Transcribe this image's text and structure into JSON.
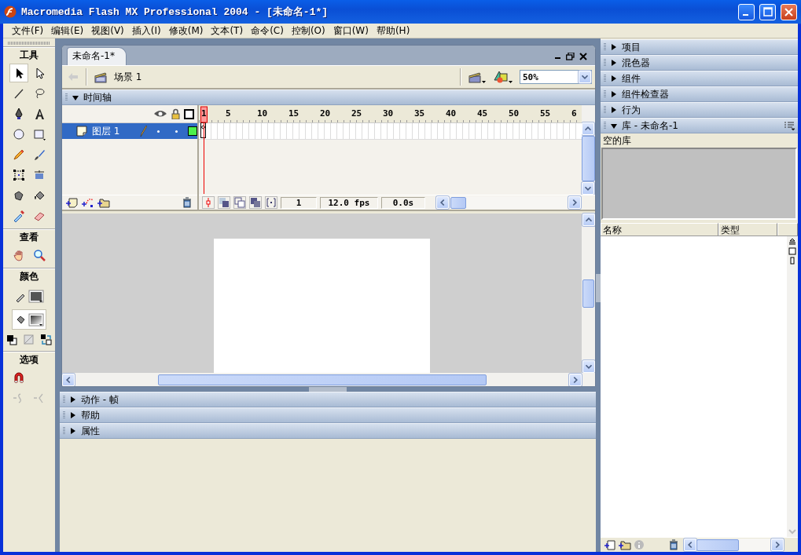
{
  "window": {
    "title": "Macromedia Flash MX Professional 2004 - [未命名-1*]"
  },
  "menu": [
    {
      "label": "文件(F)"
    },
    {
      "label": "编辑(E)"
    },
    {
      "label": "视图(V)"
    },
    {
      "label": "插入(I)"
    },
    {
      "label": "修改(M)"
    },
    {
      "label": "文本(T)"
    },
    {
      "label": "命令(C)"
    },
    {
      "label": "控制(O)"
    },
    {
      "label": "窗口(W)"
    },
    {
      "label": "帮助(H)"
    }
  ],
  "toolbox": [
    {
      "title": "工具",
      "tools": [
        {
          "kind": "arrow",
          "selected": true
        },
        {
          "kind": "subselect",
          "selected": false
        },
        {
          "kind": "line",
          "selected": false
        },
        {
          "kind": "lasso",
          "selected": false
        },
        {
          "kind": "pen",
          "selected": false
        },
        {
          "kind": "text",
          "selected": false
        },
        {
          "kind": "oval",
          "selected": false
        },
        {
          "kind": "rectangle",
          "selected": false
        },
        {
          "kind": "pencil",
          "selected": false
        },
        {
          "kind": "brush",
          "selected": false
        },
        {
          "kind": "free-transform",
          "selected": false
        },
        {
          "kind": "fill-transform",
          "selected": false
        },
        {
          "kind": "ink-bottle",
          "selected": false
        },
        {
          "kind": "paint-bucket",
          "selected": false
        },
        {
          "kind": "eyedropper",
          "selected": false
        },
        {
          "kind": "eraser",
          "selected": false
        }
      ]
    },
    {
      "title": "查看",
      "tools": [
        {
          "kind": "hand",
          "selected": false
        },
        {
          "kind": "zoom",
          "selected": false
        }
      ]
    },
    {
      "title": "颜色",
      "tools": [
        {
          "kind": "stroke-color",
          "selected": false
        },
        {
          "kind": "fill-color",
          "selected": true
        },
        {
          "kind": "default-colors",
          "selected": false
        },
        {
          "kind": "no-color",
          "selected": false
        },
        {
          "kind": "swap-colors",
          "selected": false
        }
      ]
    },
    {
      "title": "选项",
      "tools": [
        {
          "kind": "magnet",
          "disabled": false
        },
        {
          "kind": "smooth",
          "disabled": true
        },
        {
          "kind": "straighten",
          "disabled": true
        }
      ]
    }
  ],
  "document": {
    "tab": "未命名-1*",
    "scene": "场景 1",
    "zoom": "50%",
    "timeline": {
      "title": "时间轴",
      "expanded": true,
      "layers": [
        {
          "name": "图层 1",
          "selected": true
        }
      ],
      "ruler": [
        "1",
        "5",
        "10",
        "15",
        "20",
        "25",
        "30",
        "35",
        "40",
        "45",
        "50",
        "55",
        "6"
      ],
      "current_frame": "1",
      "frame_rate": "12.0 fps",
      "elapsed": "0.0s"
    }
  },
  "bottom_panels": [
    {
      "title": "动作 - 帧",
      "expanded": false
    },
    {
      "title": "帮助",
      "expanded": false
    },
    {
      "title": "属性",
      "expanded": false
    }
  ],
  "right_panels": [
    {
      "title": "项目",
      "expanded": false
    },
    {
      "title": "混色器",
      "expanded": false
    },
    {
      "title": "组件",
      "expanded": false
    },
    {
      "title": "组件检查器",
      "expanded": false
    },
    {
      "title": "行为",
      "expanded": false
    },
    {
      "title": "库 - 未命名-1",
      "expanded": true
    }
  ],
  "library": {
    "status": "空的库",
    "columns": [
      "名称",
      "类型"
    ]
  }
}
